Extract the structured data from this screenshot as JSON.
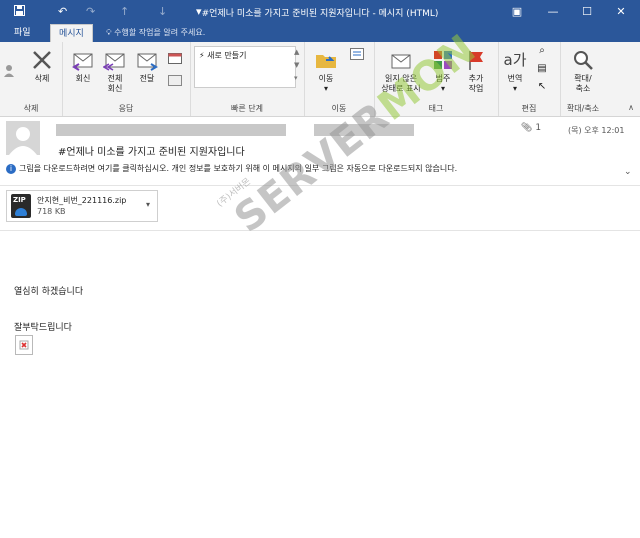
{
  "window": {
    "title": "#언제나 미소를 가지고 준비된 지원자입니다 - 메시지 (HTML)"
  },
  "tabs": [
    {
      "label": "파일"
    },
    {
      "label": "메시지"
    }
  ],
  "tell_me": "수행할 작업을 알려 주세요.",
  "ribbon": {
    "groups": {
      "delete": "삭제",
      "respond": "응답",
      "quick_steps": "빠른 단계",
      "move": "이동",
      "tags": "태그",
      "edit": "편집",
      "zoom": "확대/축소"
    },
    "buttons": {
      "delete": "삭제",
      "reply": "회신",
      "reply_all_1": "전체",
      "reply_all_2": "회신",
      "forward": "전달",
      "quick_new": "새로 만들기",
      "move": "이동",
      "unread_1": "읽지 않은",
      "unread_2": "상태로 표시",
      "categorize": "범주",
      "followup_1": "추가",
      "followup_2": "작업",
      "translate": "번역",
      "zoom_1": "확대/",
      "zoom_2": "축소"
    }
  },
  "message": {
    "subject": "#언제나 미소를 가지고 준비된 지원자입니다",
    "attachment_count": "1",
    "time": "(목) 오후 12:01",
    "info_bar": "그림을 다운로드하려면 여기를 클릭하십시오. 개인 정보를 보호하기 위해 이 메시지의 일부 그림은 자동으로 다운로드되지 않습니다.",
    "attachment": {
      "name": "안지현_비번_221116.zip",
      "size": "718 KB",
      "icon_label": "ZIP"
    },
    "body": {
      "line1": "열심히 하겠습니다",
      "line2": "잘부탁드립니다"
    }
  },
  "watermark": {
    "brand_a": "SERVER",
    "brand_b": "MON",
    "sub": "(주)서버몬"
  },
  "colors": {
    "accent": "#2b579a",
    "bg": "#ffffff",
    "ribbon_bg": "#f3f3f3"
  }
}
